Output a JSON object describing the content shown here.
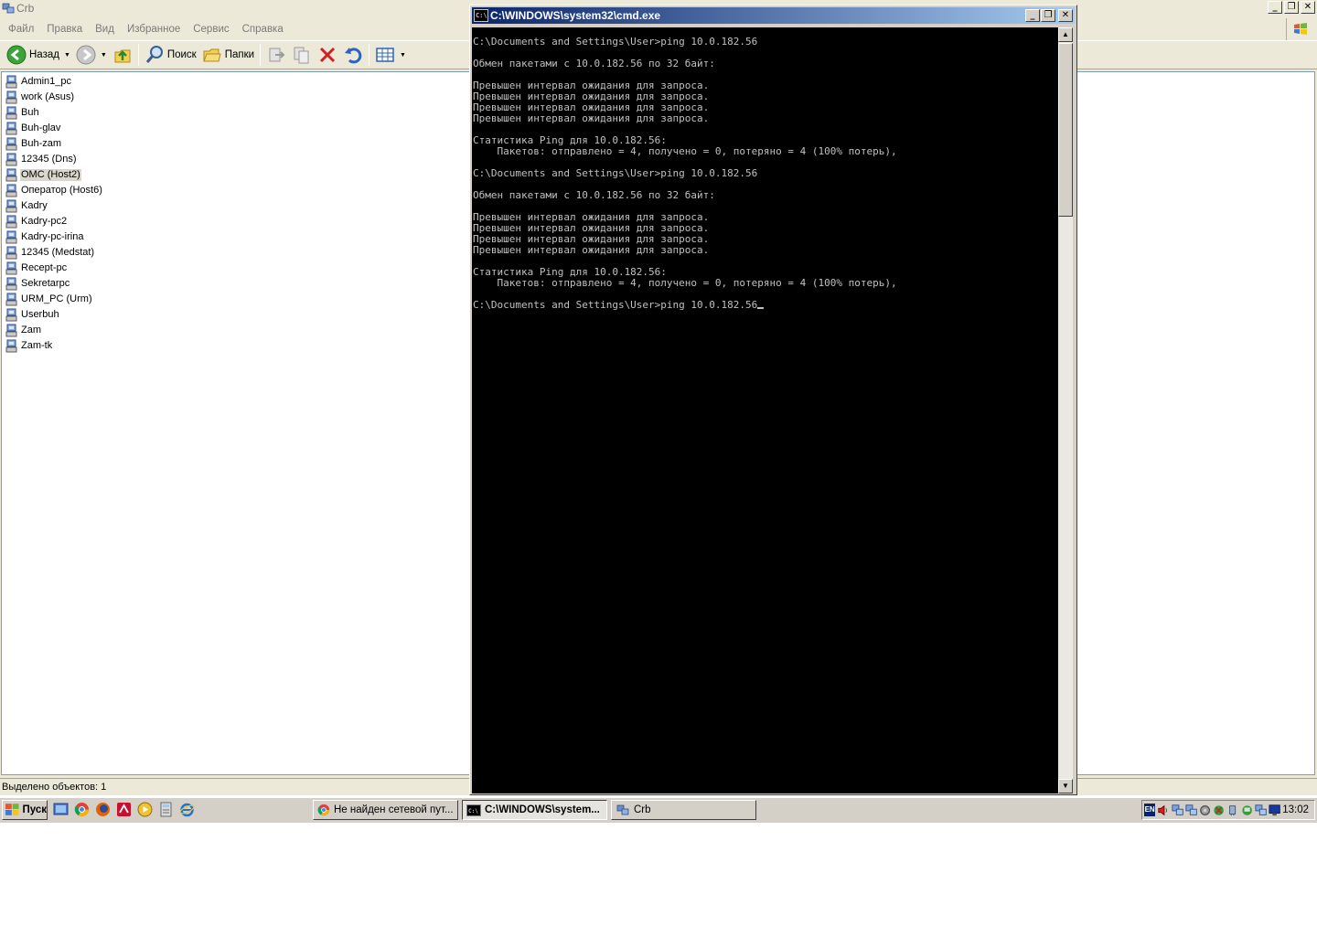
{
  "explorer": {
    "title": "Crb",
    "menu": [
      "Файл",
      "Правка",
      "Вид",
      "Избранное",
      "Сервис",
      "Справка"
    ],
    "toolbar": {
      "back": "Назад",
      "search": "Поиск",
      "folders": "Папки"
    },
    "items": [
      "Admin1_pc",
      "work (Asus)",
      "Buh",
      "Buh-glav",
      "Buh-zam",
      "12345 (Dns)",
      "OMC (Host2)",
      "Оператор (Host6)",
      "Kadry",
      "Kadry-pc2",
      "Kadry-pc-irina",
      "12345 (Medstat)",
      "Recept-pc",
      "Sekretarpc",
      "URM_PC (Urm)",
      "Userbuh",
      "Zam",
      "Zam-tk"
    ],
    "selected_item": "OMC (Host2)",
    "status": "Выделено объектов: 1"
  },
  "console": {
    "title": "C:\\WINDOWS\\system32\\cmd.exe",
    "lines": [
      "C:\\Documents and Settings\\User>ping 10.0.182.56",
      "",
      "Обмен пакетами с 10.0.182.56 по 32 байт:",
      "",
      "Превышен интервал ожидания для запроса.",
      "Превышен интервал ожидания для запроса.",
      "Превышен интервал ожидания для запроса.",
      "Превышен интервал ожидания для запроса.",
      "",
      "Статистика Ping для 10.0.182.56:",
      "    Пакетов: отправлено = 4, получено = 0, потеряно = 4 (100% потерь),",
      "",
      "C:\\Documents and Settings\\User>ping 10.0.182.56",
      "",
      "Обмен пакетами с 10.0.182.56 по 32 байт:",
      "",
      "Превышен интервал ожидания для запроса.",
      "Превышен интервал ожидания для запроса.",
      "Превышен интервал ожидания для запроса.",
      "Превышен интервал ожидания для запроса.",
      "",
      "Статистика Ping для 10.0.182.56:",
      "    Пакетов: отправлено = 4, получено = 0, потеряно = 4 (100% потерь),",
      "",
      "C:\\Documents and Settings\\User>ping 10.0.182.56"
    ]
  },
  "taskbar": {
    "start": "Пуск",
    "tasks": [
      {
        "label": "Не найден сетевой пут...",
        "icon": "chrome-icon"
      },
      {
        "label": "C:\\WINDOWS\\system...",
        "icon": "cmd-icon"
      },
      {
        "label": "Crb",
        "icon": "network-folder-icon"
      }
    ],
    "lang": "EN",
    "clock": "13:02"
  }
}
